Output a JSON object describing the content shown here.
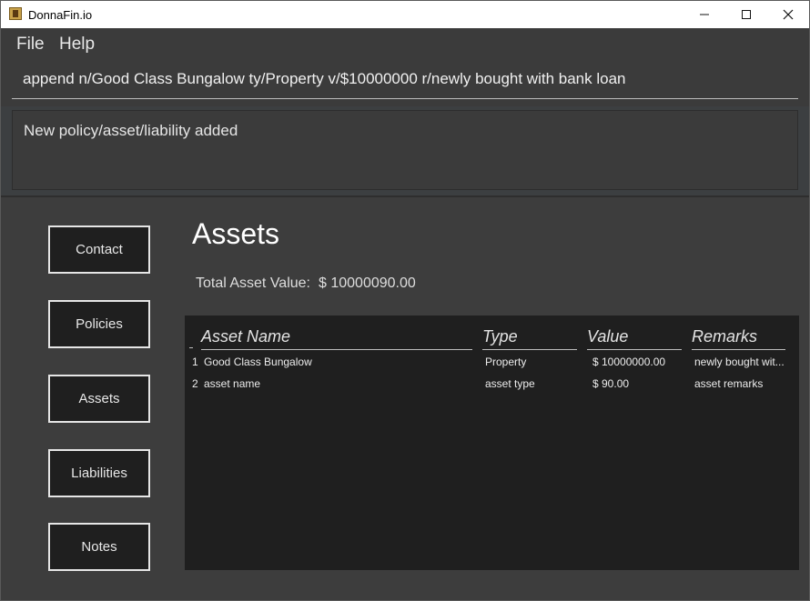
{
  "window": {
    "title": "DonnaFin.io"
  },
  "menu": {
    "file": "File",
    "help": "Help"
  },
  "command": {
    "value": "append n/Good Class Bungalow ty/Property v/$10000000 r/newly bought with bank loan"
  },
  "result": {
    "message": "New policy/asset/liability added"
  },
  "nav": {
    "contact": "Contact",
    "policies": "Policies",
    "assets": "Assets",
    "liabilities": "Liabilities",
    "notes": "Notes"
  },
  "page": {
    "title": "Assets",
    "total_label": "Total Asset Value:",
    "total_value": "$ 10000090.00"
  },
  "table": {
    "headers": [
      "Asset Name",
      "Type",
      "Value",
      "Remarks"
    ],
    "rows": [
      {
        "index": "1",
        "name": "Good Class Bungalow",
        "type": "Property",
        "value": "$ 10000000.00",
        "remarks": "newly bought wit..."
      },
      {
        "index": "2",
        "name": "asset name",
        "type": "asset type",
        "value": "$ 90.00",
        "remarks": "asset remarks"
      }
    ]
  }
}
